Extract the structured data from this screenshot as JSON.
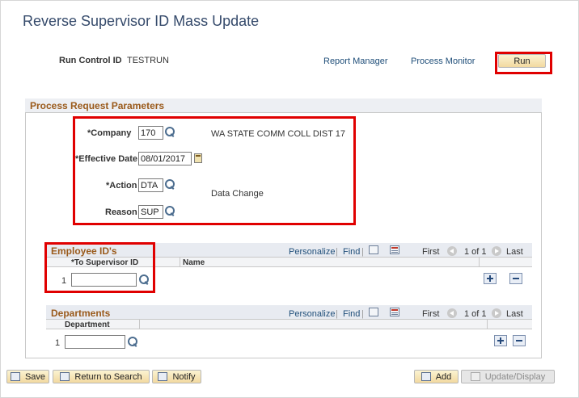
{
  "page": {
    "title": "Reverse Supervisor ID Mass Update"
  },
  "run_control": {
    "label": "Run Control ID",
    "value": "TESTRUN",
    "report_manager": "Report Manager",
    "process_monitor": "Process Monitor",
    "run_button": "Run"
  },
  "params": {
    "header": "Process Request Parameters",
    "company_label": "*Company",
    "company_value": "170",
    "company_desc": "WA STATE COMM COLL DIST 17",
    "eff_date_label": "*Effective Date",
    "eff_date_value": "08/01/2017",
    "action_label": "*Action",
    "action_value": "DTA",
    "action_desc": "Data Change",
    "reason_label": "Reason",
    "reason_value": "SUP"
  },
  "employee_grid": {
    "header": "Employee ID's",
    "personalize": "Personalize",
    "find": "Find",
    "sep": "|",
    "first": "First",
    "range": "1 of 1",
    "last": "Last",
    "col1": "*To Supervisor ID",
    "col2": "Name",
    "row_num": "1",
    "row_value": ""
  },
  "departments_grid": {
    "header": "Departments",
    "personalize": "Personalize",
    "find": "Find",
    "sep": "|",
    "first": "First",
    "range": "1 of 1",
    "last": "Last",
    "col1": "Department",
    "row_num": "1",
    "row_value": ""
  },
  "toolbar": {
    "save": "Save",
    "return_to_search": "Return to Search",
    "notify": "Notify",
    "add": "Add",
    "update_display": "Update/Display"
  },
  "colors": {
    "accent": "#354a6b",
    "section_title": "#9a5a1b",
    "highlight": "#e00000"
  },
  "icons": [
    "search-icon",
    "calendar-icon",
    "grid-icon",
    "chart-icon",
    "add-row-icon",
    "delete-row-icon",
    "save-icon",
    "notify-icon",
    "add-icon"
  ]
}
